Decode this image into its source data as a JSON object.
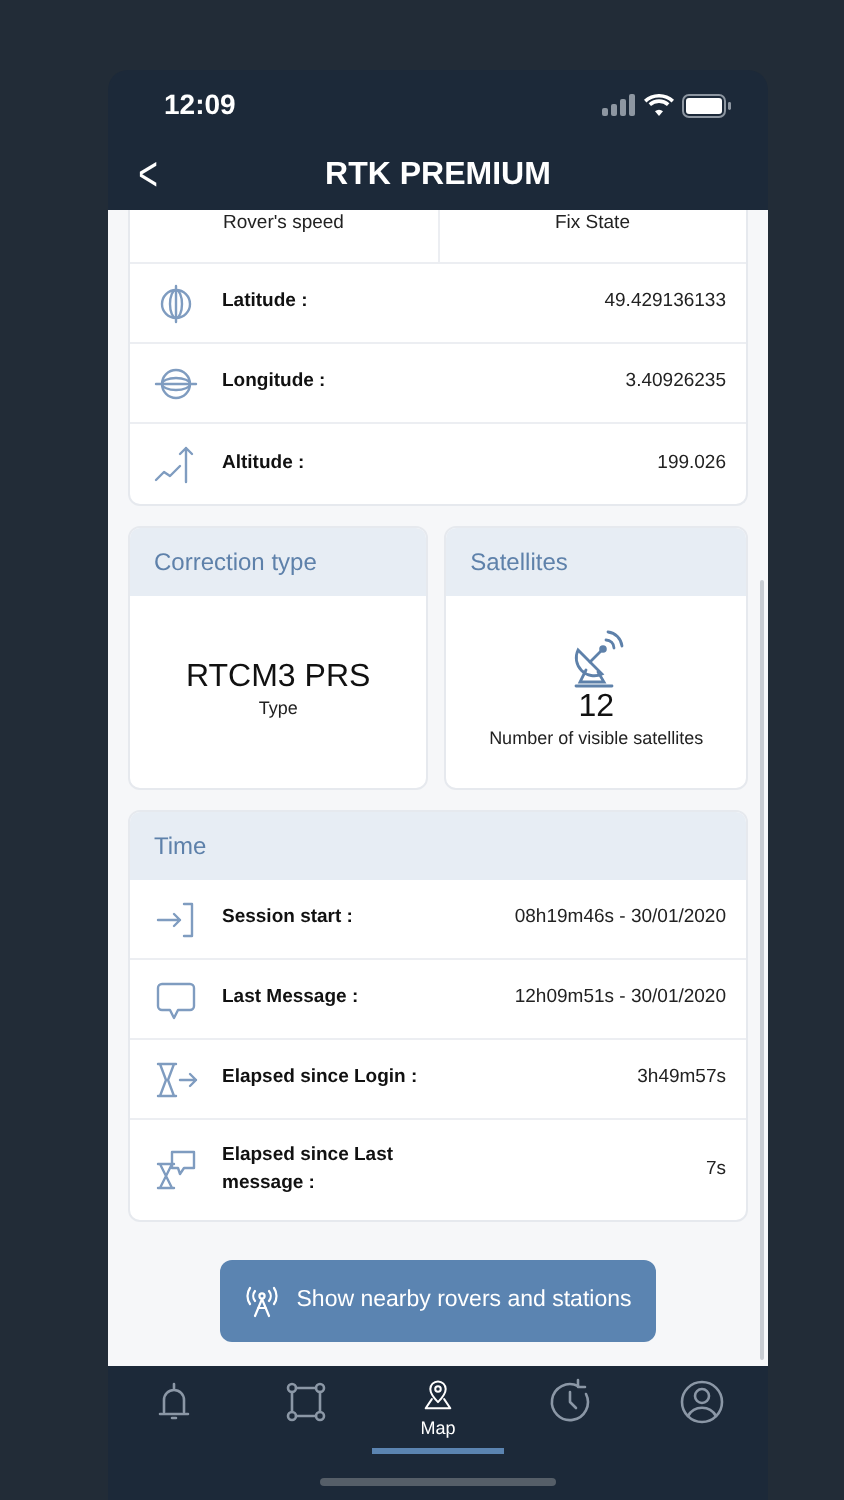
{
  "status_bar": {
    "time": "12:09"
  },
  "header": {
    "back": "<",
    "title": "RTK PREMIUM"
  },
  "position": {
    "stats": [
      {
        "label": "Rover's speed"
      },
      {
        "label": "Fix State"
      }
    ],
    "rows": [
      {
        "kind": "latitude",
        "label": "Latitude :",
        "value": "49.429136133"
      },
      {
        "kind": "longitude",
        "label": "Longitude :",
        "value": "3.40926235"
      },
      {
        "kind": "altitude",
        "label": "Altitude :",
        "value": "199.026"
      }
    ]
  },
  "correction": {
    "title": "Correction type",
    "value": "RTCM3 PRS",
    "caption": "Type"
  },
  "satellites": {
    "title": "Satellites",
    "value": "12",
    "caption": "Number of visible satellites"
  },
  "time": {
    "title": "Time",
    "rows": [
      {
        "kind": "login",
        "label": "Session start :",
        "value": "08h19m46s - 30/01/2020"
      },
      {
        "kind": "message",
        "label": "Last Message :",
        "value": "12h09m51s - 30/01/2020"
      },
      {
        "kind": "elapsed",
        "label": "Elapsed since Login :",
        "value": "3h49m57s"
      },
      {
        "kind": "elapsed-message",
        "label": "Elapsed since Last message :",
        "value": "7s"
      }
    ]
  },
  "action_button": {
    "label": "Show nearby rovers and stations"
  },
  "tabs": [
    {
      "kind": "alerts",
      "selected": false
    },
    {
      "kind": "network",
      "selected": false
    },
    {
      "kind": "map",
      "label": "Map",
      "selected": true
    },
    {
      "kind": "history",
      "selected": false
    },
    {
      "kind": "profile",
      "selected": false
    }
  ]
}
